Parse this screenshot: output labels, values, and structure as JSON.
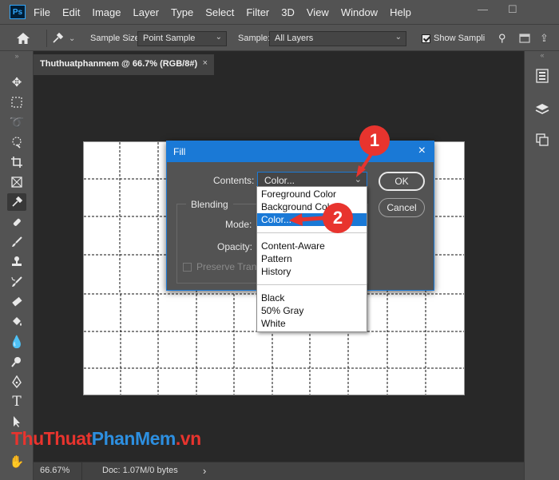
{
  "app": {
    "logo": "Ps"
  },
  "menubar": {
    "items": [
      "File",
      "Edit",
      "Image",
      "Layer",
      "Type",
      "Select",
      "Filter",
      "3D",
      "View",
      "Window",
      "Help"
    ],
    "minimize": "—",
    "maximize": "☐"
  },
  "options": {
    "sample_size_label": "Sample Size:",
    "sample_size_value": "Point Sample",
    "sample_label": "Sample:",
    "sample_value": "All Layers",
    "show_sampling_label": "Show Sampli",
    "show_sampling_checked": true
  },
  "document": {
    "tab_title": "Thuthuatphanmem @ 66.7% (RGB/8#)",
    "tab_close": "×",
    "zoom": "66.67%",
    "doc_info": "Doc: 1.07M/0 bytes",
    "status_arrow": "›"
  },
  "fill_dialog": {
    "title": "Fill",
    "close": "×",
    "contents_label": "Contents:",
    "contents_value": "Color...",
    "blending_label": "Blending",
    "mode_label": "Mode:",
    "opacity_label": "Opacity:",
    "preserve_label": "Preserve Trans",
    "ok_label": "OK",
    "cancel_label": "Cancel"
  },
  "dropdown": {
    "items": [
      "Foreground Color",
      "Background Color",
      "Color...",
      "Content-Aware",
      "Pattern",
      "History",
      "Black",
      "50% Gray",
      "White"
    ],
    "selected_index": 2
  },
  "badges": {
    "one": "1",
    "two": "2"
  },
  "watermark": {
    "part1": "ThuThuat",
    "part2": "PhanMem",
    "part3": ".vn"
  },
  "colors": {
    "accent": "#1a79d6",
    "badge": "#e8342e",
    "panel": "#535353",
    "canvas_bg": "#282828"
  },
  "icons": [
    "home-icon",
    "eyedropper-icon",
    "move-icon",
    "marquee-icon",
    "lasso-icon",
    "quick-select-icon",
    "crop-icon",
    "frame-icon",
    "brush-icon",
    "stamp-icon",
    "eraser-icon",
    "bucket-icon",
    "pen-icon",
    "type-icon",
    "hand-icon"
  ]
}
